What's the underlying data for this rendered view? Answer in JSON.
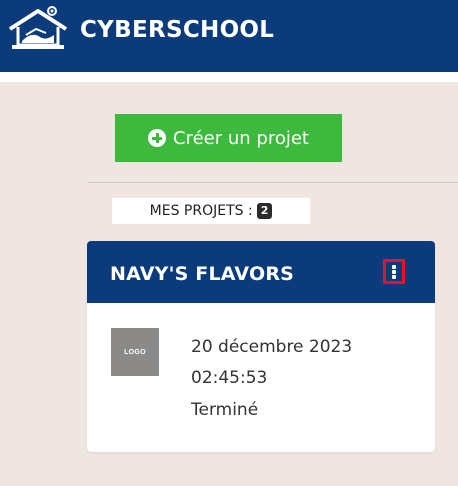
{
  "header": {
    "brand": "CYBERSCHOOL",
    "logo_icon": "school-house-logo-icon",
    "bg_color": "#0b3b7b"
  },
  "actions": {
    "create_project_label": "Créer un projet",
    "create_icon": "plus-circle-icon",
    "accent_color": "#3db93d"
  },
  "projects_section": {
    "label": "MES PROJETS :",
    "count": "2"
  },
  "project_card": {
    "title": "NAVY'S FLAVORS",
    "menu_icon": "kebab-menu-icon",
    "logo_text": "LOGO",
    "date": "20 décembre 2023",
    "time": "02:45:53",
    "status": "Terminé"
  }
}
